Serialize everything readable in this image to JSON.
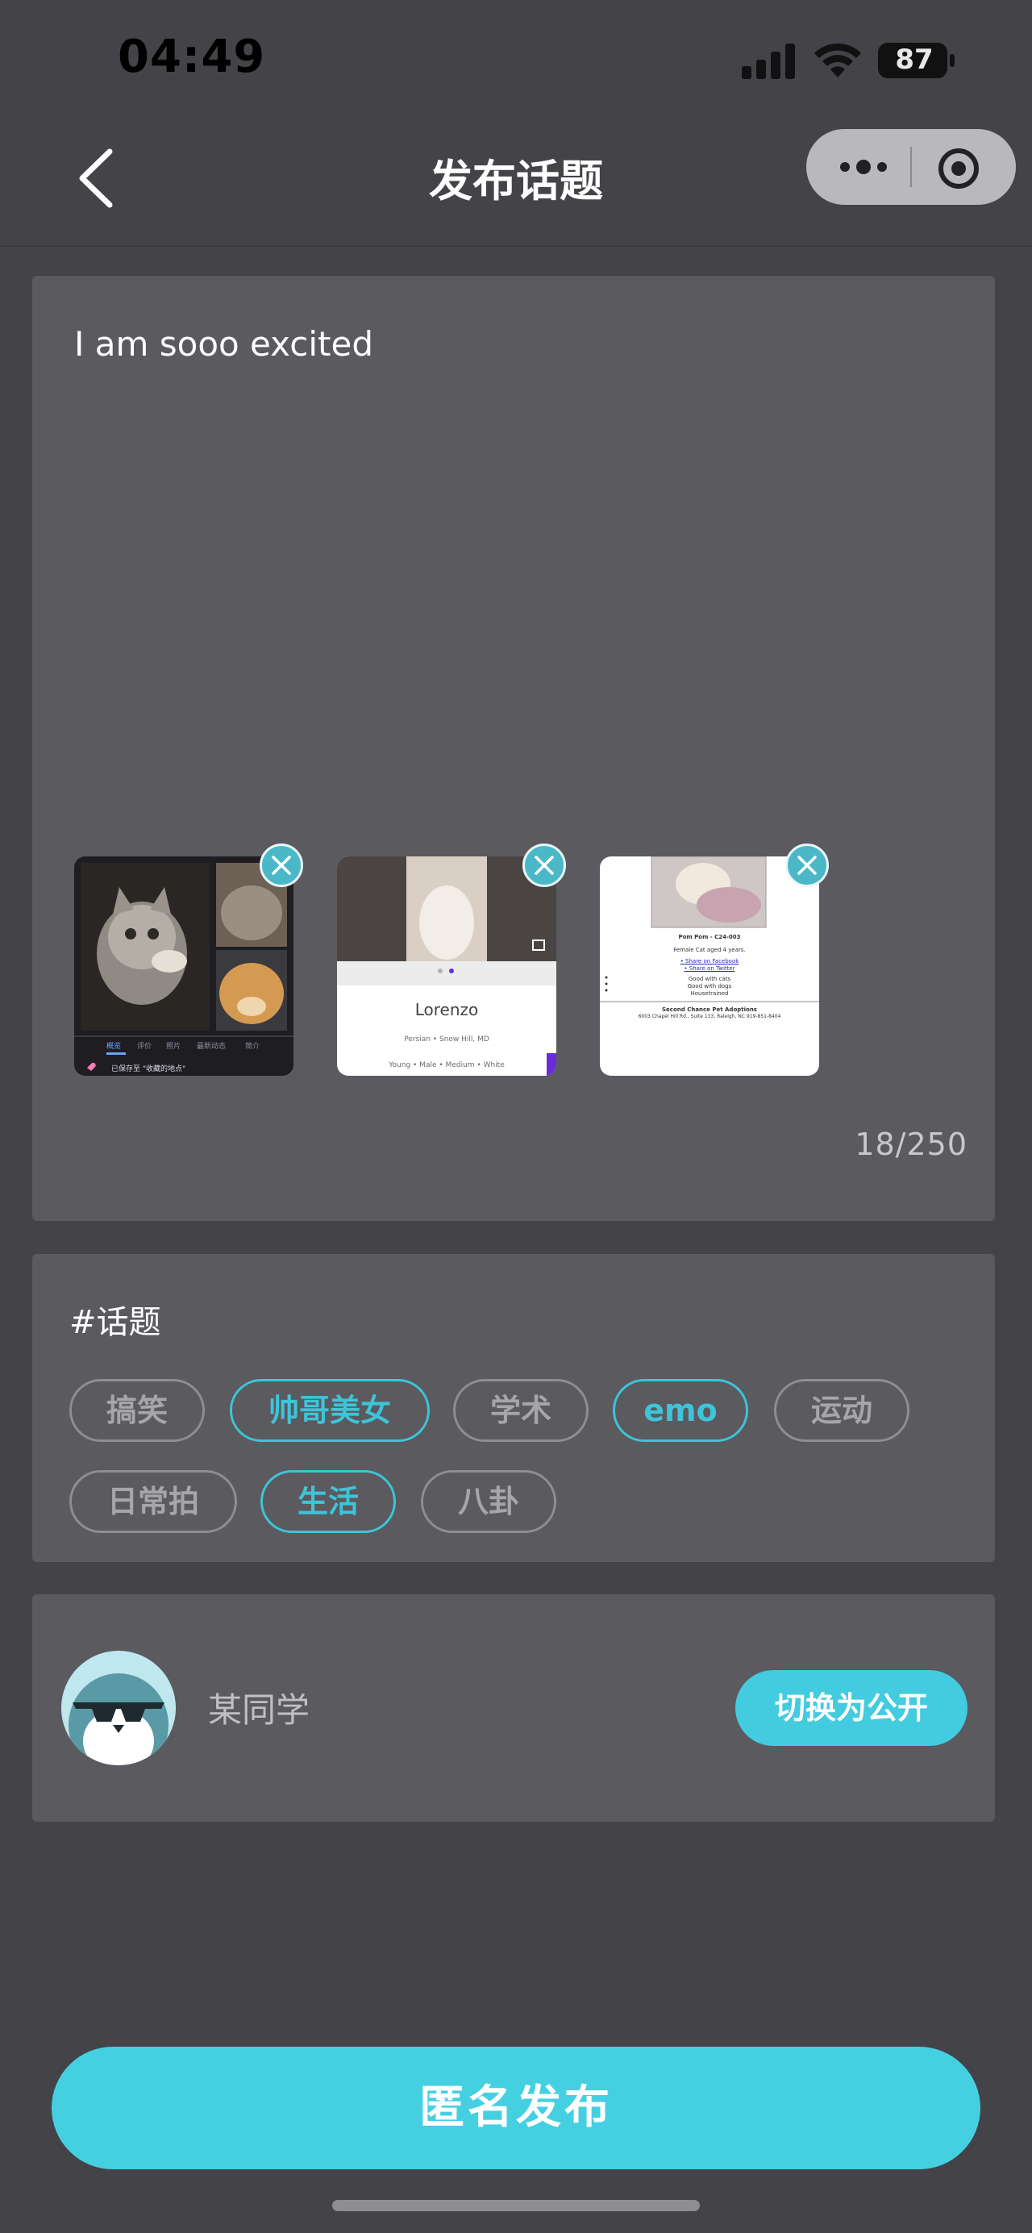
{
  "status_bar": {
    "time": "04:49",
    "battery": "87"
  },
  "nav": {
    "title": "发布话题"
  },
  "compose": {
    "text": "I am sooo excited",
    "counter": "18/250",
    "thumb2_caption": "Lorenzo",
    "thumb2_meta1": "Persian • Snow Hill, MD",
    "thumb2_meta2": "Young • Male • Medium • White",
    "thumb3_title": "Pom Pom - C24-003",
    "thumb3_sub": "Female Cat aged 4 years.",
    "thumb3_link1": "• Share on Facebook",
    "thumb3_link2": "• Share on Twitter",
    "thumb3_l1": "Good with cats",
    "thumb3_l2": "Good with dogs",
    "thumb3_l3": "Housetrained",
    "thumb3_org": "Second Chance Pet Adoptions",
    "thumb3_addr": "6003 Chapel Hill Rd., Suite 133, Raleigh, NC 919-851-8404",
    "thumb1_tabs": [
      "概览",
      "评价",
      "照片",
      "最新动态",
      "简介"
    ],
    "thumb1_saved": "已保存至 \"收藏的地点\""
  },
  "topics": {
    "heading": "#话题",
    "tags": [
      {
        "label": "搞笑",
        "active": false
      },
      {
        "label": "帅哥美女",
        "active": true
      },
      {
        "label": "学术",
        "active": false
      },
      {
        "label": "emo",
        "active": true
      },
      {
        "label": "运动",
        "active": false
      },
      {
        "label": "日常拍",
        "active": false
      },
      {
        "label": "生活",
        "active": true
      },
      {
        "label": "八卦",
        "active": false
      }
    ]
  },
  "identity": {
    "name": "某同学",
    "switch_label": "切换为公开"
  },
  "publish": {
    "label": "匿名发布"
  },
  "colors": {
    "accent": "#45d0e2",
    "card": "#5a5a5f",
    "background": "#434348"
  }
}
